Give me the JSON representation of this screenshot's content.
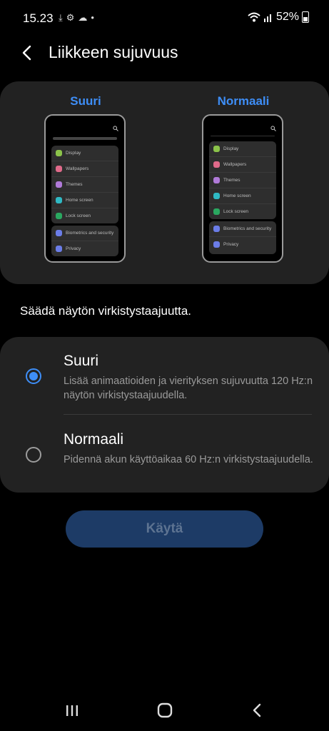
{
  "status_bar": {
    "time": "15.23",
    "battery": "52%"
  },
  "header": {
    "title": "Liikkeen sujuvuus"
  },
  "preview": {
    "left_label": "Suuri",
    "right_label": "Normaali",
    "menu_items_group1": [
      "Display",
      "Wallpapers",
      "Themes",
      "Home screen",
      "Lock screen"
    ],
    "menu_items_group2": [
      "Biometrics and security",
      "Privacy"
    ],
    "icon_colors": [
      "#8bc34a",
      "#e06a8a",
      "#b07ad8",
      "#2fb9c4",
      "#2aa860",
      "#6b7de8",
      "#6b7de8"
    ]
  },
  "section_label": "Säädä näytön virkistystaajuutta.",
  "options": [
    {
      "title": "Suuri",
      "description": "Lisää animaatioiden ja vierityksen sujuvuutta 120 Hz:n näytön virkistystaajuudella.",
      "selected": true
    },
    {
      "title": "Normaali",
      "description": "Pidennä akun käyttöaikaa 60 Hz:n virkistystaajuudella.",
      "selected": false
    }
  ],
  "apply_button": "Käytä",
  "colors": {
    "accent": "#3e8ef7",
    "card": "#222222",
    "button_bg": "#1d3b66"
  }
}
